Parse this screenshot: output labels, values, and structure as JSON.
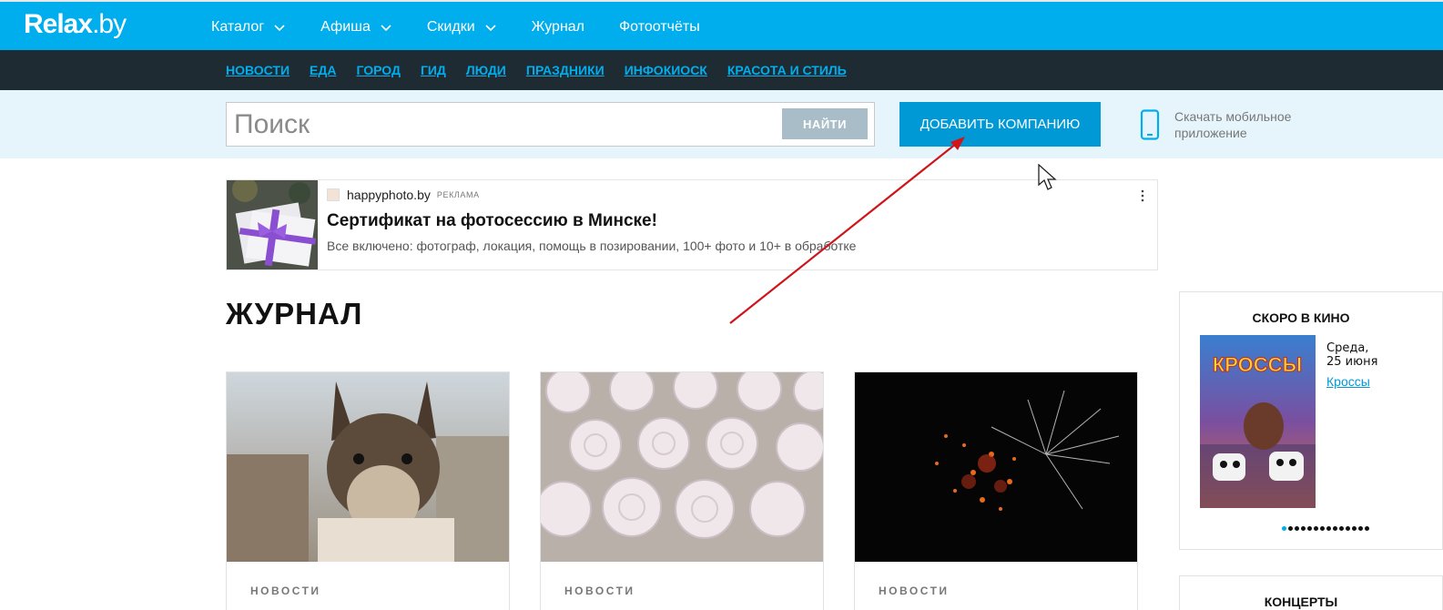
{
  "header": {
    "logo": "Relax",
    "logo_suffix": ".by",
    "nav": [
      {
        "label": "Каталог",
        "dropdown": true
      },
      {
        "label": "Афиша",
        "dropdown": true
      },
      {
        "label": "Скидки",
        "dropdown": true
      },
      {
        "label": "Журнал",
        "dropdown": false
      },
      {
        "label": "Фотоотчёты",
        "dropdown": false
      }
    ]
  },
  "subnav": [
    "НОВОСТИ",
    "ЕДА",
    "ГОРОД",
    "ГИД",
    "ЛЮДИ",
    "ПРАЗДНИКИ",
    "ИНФОКИОСК",
    "КРАСОТА И СТИЛЬ"
  ],
  "search": {
    "placeholder": "Поиск",
    "button": "НАЙТИ",
    "add_company": "ДОБАВИТЬ КОМПАНИЮ",
    "mobile_app": "Скачать мобильное приложение"
  },
  "ad": {
    "source": "happyphoto.by",
    "badge": "РЕКЛАМА",
    "title": "Сертификат на фотосессию в Минске!",
    "description": "Все включено: фотограф, локация, помощь в позировании, 100+ фото и 10+ в обработке"
  },
  "journal": {
    "title": "ЖУРНАЛ",
    "cards": [
      {
        "tag": "НОВОСТИ"
      },
      {
        "tag": "НОВОСТИ"
      },
      {
        "tag": "НОВОСТИ"
      }
    ]
  },
  "sidebar": {
    "cinema_title": "СКОРО В КИНО",
    "date_line1": "Среда,",
    "date_line2": "25 июня",
    "film": "Кроссы",
    "poster_title": "КРОССЫ",
    "carousel": {
      "count": 14,
      "active": 0
    },
    "concerts_title": "КОНЦЕРТЫ"
  },
  "colors": {
    "brand": "#00aded",
    "dark_bar": "#1e2b33",
    "add_button": "#0099d6",
    "annotation_arrow": "#d0141a"
  }
}
